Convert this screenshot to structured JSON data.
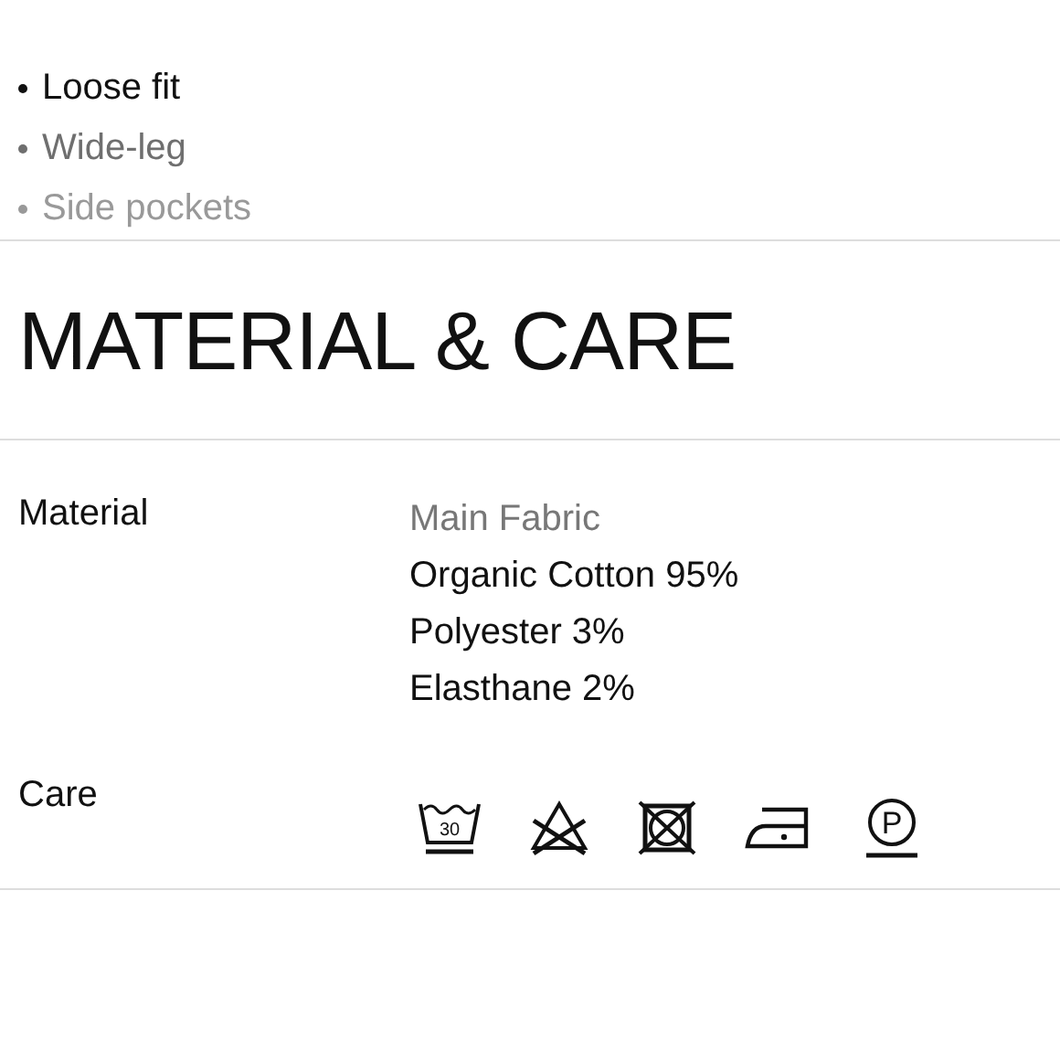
{
  "features": [
    "Loose fit",
    "Wide-leg",
    "Side pockets"
  ],
  "section": {
    "title": "MATERIAL & CARE"
  },
  "material": {
    "label": "Material",
    "subheading": "Main Fabric",
    "lines": [
      "Organic Cotton 95%",
      "Polyester 3%",
      "Elasthane 2%"
    ]
  },
  "care": {
    "label": "Care",
    "symbols": [
      {
        "kind": "wash",
        "temperature": "30"
      },
      {
        "kind": "no-bleach"
      },
      {
        "kind": "no-tumble-dry"
      },
      {
        "kind": "iron"
      },
      {
        "kind": "dry-clean",
        "letter": "P"
      }
    ]
  }
}
